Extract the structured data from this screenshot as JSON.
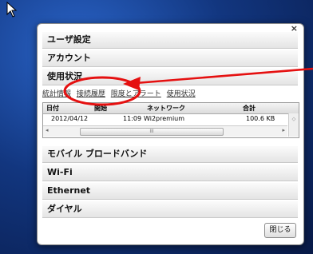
{
  "panel": {
    "close_glyph": "×"
  },
  "sections": {
    "user_settings": "ユーザ設定",
    "account": "アカウント",
    "usage": "使用状況",
    "mobile_broadband": "モバイル ブロードバンド",
    "wifi": "Wi-Fi",
    "ethernet": "Ethernet",
    "dial": "ダイヤル"
  },
  "tabs": [
    "統計情報",
    "接続履歴",
    "限度とアラート",
    "使用状況"
  ],
  "table": {
    "headers": [
      "日付",
      "開始",
      "ネットワーク",
      "合計"
    ],
    "rows": [
      {
        "date": "2012/04/12",
        "start": "11:09",
        "network": "Wi2premium",
        "total": "100.6 KB"
      }
    ],
    "scroll_thumb_glyph": "III",
    "left_arrow": "◂",
    "right_arrow": "▸",
    "vscroll_glyph": "⬦"
  },
  "buttons": {
    "close_label": "閉じる"
  },
  "colors": {
    "annotation": "#e51010",
    "background": "#12367f"
  }
}
